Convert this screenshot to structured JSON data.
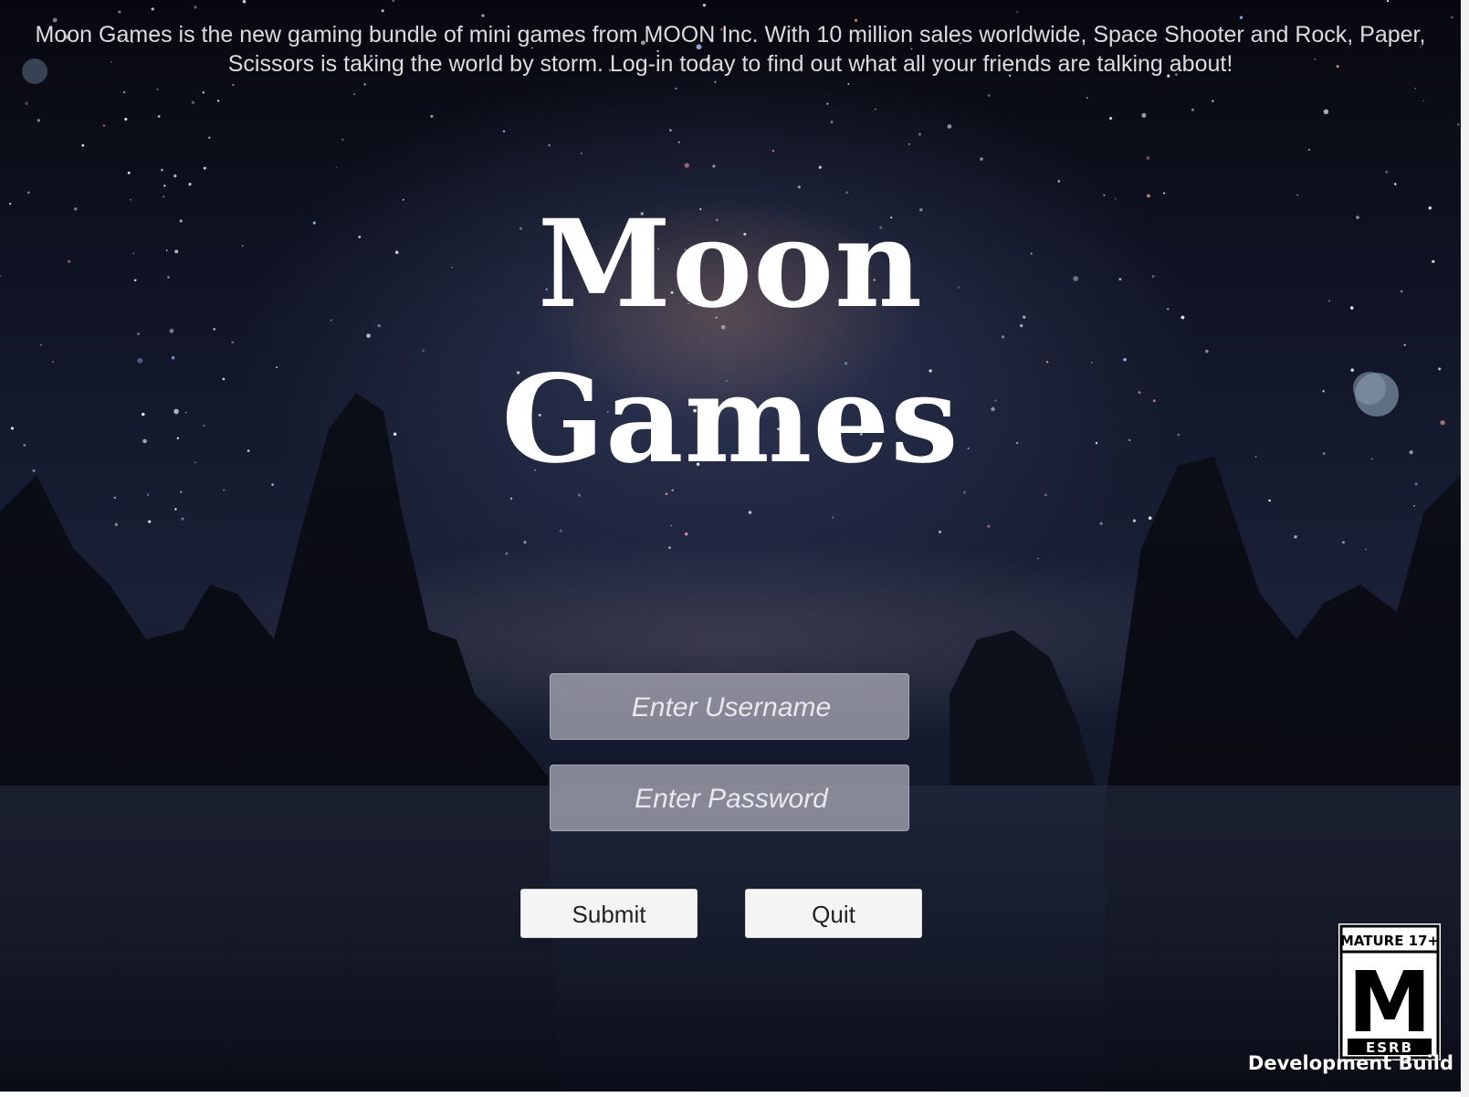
{
  "intro_text": "Moon Games is the new gaming bundle of mini games from MOON Inc. With 10 million sales worldwide, Space Shooter and Rock, Paper, Scissors is taking the world by storm. Log-in today to find out what all your friends are talking about!",
  "title": {
    "line1": "Moon",
    "line2": "Games"
  },
  "login": {
    "username_placeholder": "Enter Username",
    "password_placeholder": "Enter Password",
    "username_value": "",
    "password_value": ""
  },
  "buttons": {
    "submit_label": "Submit",
    "quit_label": "Quit"
  },
  "rating_badge": {
    "top_text": "MATURE 17+",
    "letter": "M",
    "bottom_text": "ESRB"
  },
  "build_label": "Development Build",
  "icons": {
    "rating": "esrb-mature-rating-icon"
  },
  "colors": {
    "background_dark": "#0a0d18",
    "field_fill": "#aaaab6",
    "button_fill": "#f4f4f4",
    "text_light": "#dcdcdc"
  }
}
